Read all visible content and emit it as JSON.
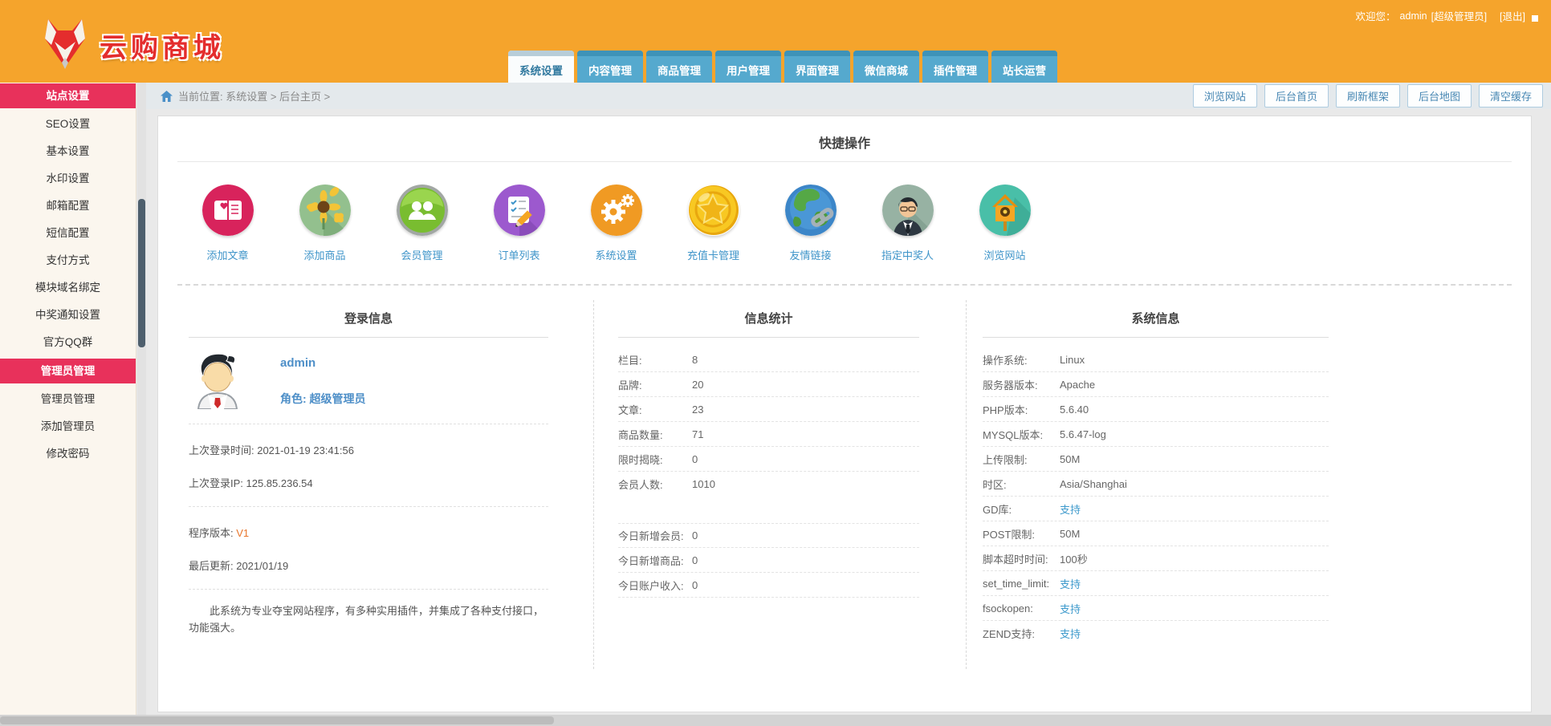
{
  "colors": {
    "header_orange": "#f5a42c",
    "accent_pink": "#e8315b",
    "tab_blue": "#55a9ce",
    "link_blue": "#3e94c9",
    "brand_red": "#e42d2d"
  },
  "header": {
    "logo_text": "云购商城",
    "welcome_prefix": "欢迎您：",
    "username": "admin",
    "role_bracket": "[超级管理员]",
    "logout": "[退出]",
    "tabs": [
      "系统设置",
      "内容管理",
      "商品管理",
      "用户管理",
      "界面管理",
      "微信商城",
      "插件管理",
      "站长运营"
    ]
  },
  "sidebar": {
    "items": [
      {
        "label": "站点设置",
        "header": true
      },
      {
        "label": "SEO设置"
      },
      {
        "label": "基本设置"
      },
      {
        "label": "水印设置"
      },
      {
        "label": "邮箱配置"
      },
      {
        "label": "短信配置"
      },
      {
        "label": "支付方式"
      },
      {
        "label": "模块域名绑定"
      },
      {
        "label": "中奖通知设置"
      },
      {
        "label": "官方QQ群"
      },
      {
        "label": "管理员管理",
        "header": true
      },
      {
        "label": "管理员管理"
      },
      {
        "label": "添加管理员"
      },
      {
        "label": "修改密码"
      }
    ]
  },
  "breadcrumb": {
    "text": "当前位置: 系统设置 > 后台主页 >"
  },
  "toolbar": {
    "buttons": [
      "浏览网站",
      "后台首页",
      "刷新框架",
      "后台地图",
      "清空缓存"
    ]
  },
  "quick_ops": {
    "title": "快捷操作",
    "items": [
      {
        "label": "添加文章",
        "icon": "article-add-icon"
      },
      {
        "label": "添加商品",
        "icon": "goods-add-icon"
      },
      {
        "label": "会员管理",
        "icon": "member-manage-icon"
      },
      {
        "label": "订单列表",
        "icon": "order-list-icon"
      },
      {
        "label": "系统设置",
        "icon": "system-settings-icon"
      },
      {
        "label": "充值卡管理",
        "icon": "recharge-card-icon"
      },
      {
        "label": "友情链接",
        "icon": "friend-links-icon"
      },
      {
        "label": "指定中奖人",
        "icon": "winner-assign-icon"
      },
      {
        "label": "浏览网站",
        "icon": "browse-site-icon"
      }
    ]
  },
  "login_info": {
    "title": "登录信息",
    "username": "admin",
    "role_line": "角色: 超级管理员",
    "last_login_time": "上次登录时间: 2021-01-19 23:41:56",
    "last_login_ip": "上次登录IP: 125.85.236.54",
    "version_label": "程序版本: ",
    "version_value": "V1",
    "last_update": "最后更新: 2021/01/19",
    "description": "此系统为专业夺宝网站程序，有多种实用插件，并集成了各种支付接口，功能强大。"
  },
  "stats": {
    "title": "信息统计",
    "rows": [
      {
        "label": "栏目:",
        "value": "8"
      },
      {
        "label": "品牌:",
        "value": "20"
      },
      {
        "label": "文章:",
        "value": "23"
      },
      {
        "label": "商品数量:",
        "value": "71"
      },
      {
        "label": "限时揭晓:",
        "value": "0"
      },
      {
        "label": "会员人数:",
        "value": "1010"
      }
    ],
    "today_rows": [
      {
        "label": "今日新增会员:",
        "value": "0"
      },
      {
        "label": "今日新增商品:",
        "value": "0"
      },
      {
        "label": "今日账户收入:",
        "value": "0"
      }
    ]
  },
  "system_info": {
    "title": "系统信息",
    "rows": [
      {
        "label": "操作系统:",
        "value": "Linux",
        "link": false
      },
      {
        "label": "服务器版本:",
        "value": "Apache",
        "link": false
      },
      {
        "label": "PHP版本:",
        "value": "5.6.40",
        "link": false
      },
      {
        "label": "MYSQL版本:",
        "value": "5.6.47-log",
        "link": false
      },
      {
        "label": "上传限制:",
        "value": "50M",
        "link": false
      },
      {
        "label": "时区:",
        "value": "Asia/Shanghai",
        "link": false
      },
      {
        "label": "GD库:",
        "value": "支持",
        "link": true
      },
      {
        "label": "POST限制:",
        "value": "50M",
        "link": false
      },
      {
        "label": "脚本超时时间:",
        "value": "100秒",
        "link": false
      },
      {
        "label": "set_time_limit:",
        "value": "支持",
        "link": true
      },
      {
        "label": "fsockopen:",
        "value": "支持",
        "link": true
      },
      {
        "label": "ZEND支持:",
        "value": "支持",
        "link": true
      }
    ]
  }
}
